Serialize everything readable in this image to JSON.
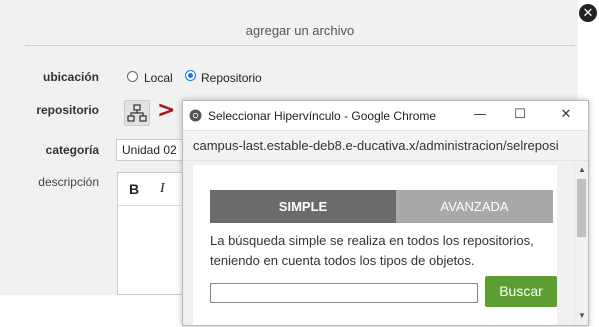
{
  "panel": {
    "title": "agregar un archivo",
    "close_glyph": "✕"
  },
  "form": {
    "ubicacion_label": "ubicación",
    "ubicacion_options": [
      {
        "label": "Local",
        "selected": false
      },
      {
        "label": "Repositorio",
        "selected": true
      }
    ],
    "repositorio_label": "repositorio",
    "repositorio_icon": "sitemap-icon",
    "arrow_glyph": ">",
    "categoria_label": "categoría",
    "categoria_value": "Unidad 02",
    "descripcion_label": "descripción",
    "editor_toolbar": {
      "bold": "B",
      "italic": "I"
    }
  },
  "popup": {
    "window_title": "Seleccionar Hipervínculo - Google Chrome",
    "url": "campus-last.estable-deb8.e-ducativa.x/administracion/selreposi",
    "controls": {
      "minimize": "—",
      "maximize": "☐",
      "close": "✕"
    },
    "tabs": {
      "simple": "SIMPLE",
      "advanced": "AVANZADA"
    },
    "description": "La búsqueda simple se realiza en todos los repositorios, teniendo en cuenta todos los tipos de objetos.",
    "search_value": "",
    "search_button": "Buscar"
  },
  "colors": {
    "accent_red": "#a4151d",
    "search_green": "#5c9e32",
    "tab_active": "#6b6b6b",
    "tab_inactive": "#a9a9a9"
  }
}
